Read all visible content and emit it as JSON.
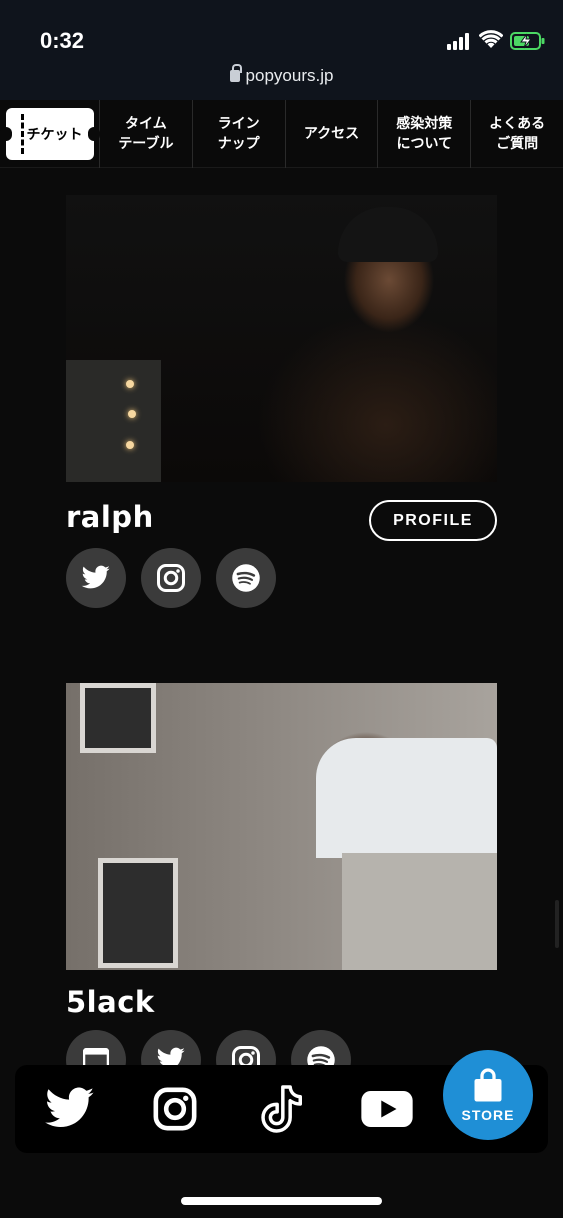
{
  "status_bar": {
    "time": "0:32",
    "url": "popyours.jp"
  },
  "nav": {
    "ticket": "チケット",
    "items": [
      {
        "label": "タイム\nテーブル"
      },
      {
        "label": "ライン\nナップ"
      },
      {
        "label": "アクセス"
      },
      {
        "label": "感染対策\nについて"
      },
      {
        "label": "よくある\nご質問"
      }
    ]
  },
  "artists": [
    {
      "name": "ralph",
      "profile_label": "PROFILE",
      "socials": [
        "twitter-icon",
        "instagram-icon",
        "spotify-icon"
      ]
    },
    {
      "name": "5lack",
      "socials": [
        "website-icon",
        "twitter-icon",
        "instagram-icon",
        "spotify-icon"
      ]
    }
  ],
  "bottom_bar": {
    "icons": [
      "twitter-icon",
      "instagram-icon",
      "tiktok-icon",
      "youtube-icon"
    ],
    "store_label": "STORE"
  },
  "colors": {
    "background": "#0b0b0b",
    "status_bar": "#0f141c",
    "store_accent": "#1f8fd6",
    "social_circle": "#3b3b3b"
  }
}
